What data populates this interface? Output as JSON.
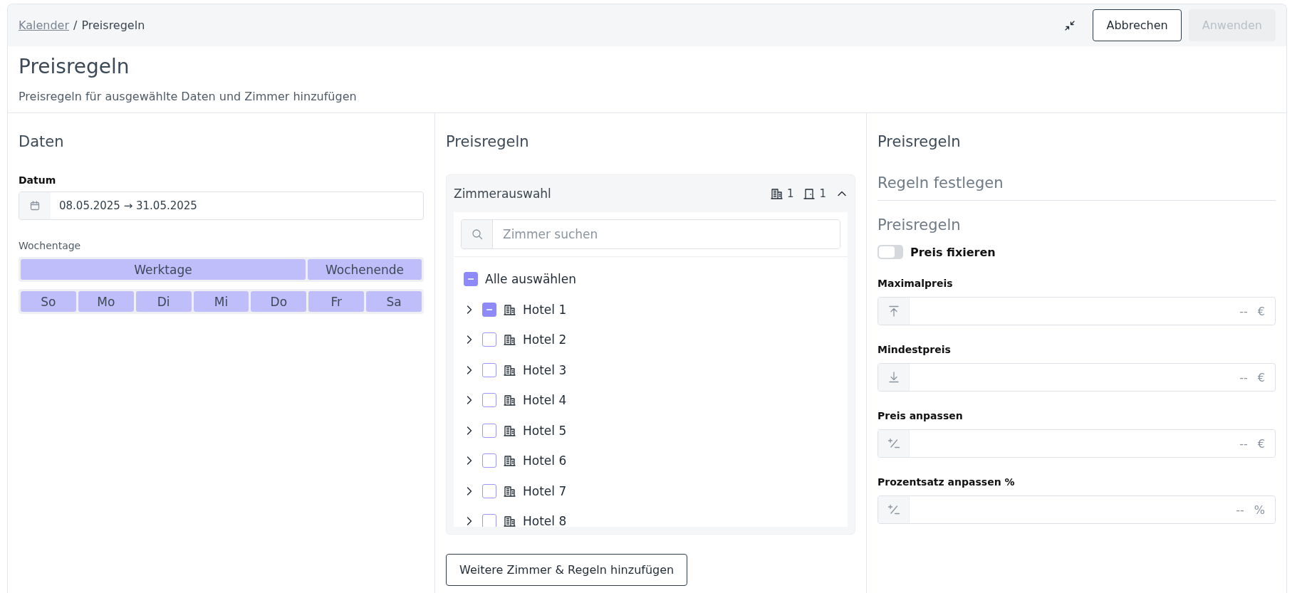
{
  "breadcrumb": {
    "link": "Kalender",
    "separator": "/",
    "current": "Preisregeln"
  },
  "toolbar": {
    "buttons": [
      {
        "label": "Abbrechen",
        "kind": "outline",
        "disabled": false
      },
      {
        "label": "Anwenden",
        "kind": "primary",
        "disabled": true
      }
    ]
  },
  "header": {
    "title": "Preisregeln",
    "subtitle": "Preisregeln für ausgewählte Daten und Zimmer hinzufügen"
  },
  "dates": {
    "title": "Daten",
    "date_label": "Datum",
    "date_value": "08.05.2025 → 31.05.2025",
    "weekdays_label": "Wochentage",
    "groups": [
      {
        "label": "Werktage",
        "selected": true
      },
      {
        "label": "Wochenende",
        "selected": true
      }
    ],
    "days": [
      {
        "label": "So",
        "selected": true
      },
      {
        "label": "Mo",
        "selected": true
      },
      {
        "label": "Di",
        "selected": true
      },
      {
        "label": "Mi",
        "selected": true
      },
      {
        "label": "Do",
        "selected": true
      },
      {
        "label": "Fr",
        "selected": true
      },
      {
        "label": "Sa",
        "selected": true
      }
    ]
  },
  "rooms": {
    "title": "Preisregeln",
    "card_title": "Zimmerauswahl",
    "hotel_count": "1",
    "room_count": "1",
    "expanded": true,
    "search_placeholder": "Zimmer suchen",
    "select_all": {
      "label": "Alle auswählen",
      "checked": false,
      "indeterminate": true
    },
    "hotels": [
      {
        "name": "Hotel 1",
        "checked": false,
        "indeterminate": true,
        "expanded": false
      },
      {
        "name": "Hotel 2",
        "checked": false,
        "indeterminate": false,
        "expanded": false
      },
      {
        "name": "Hotel 3",
        "checked": false,
        "indeterminate": false,
        "expanded": false
      },
      {
        "name": "Hotel 4",
        "checked": false,
        "indeterminate": false,
        "expanded": false
      },
      {
        "name": "Hotel 5",
        "checked": false,
        "indeterminate": false,
        "expanded": false
      },
      {
        "name": "Hotel 6",
        "checked": false,
        "indeterminate": false,
        "expanded": false
      },
      {
        "name": "Hotel 7",
        "checked": false,
        "indeterminate": false,
        "expanded": false
      },
      {
        "name": "Hotel 8",
        "checked": false,
        "indeterminate": false,
        "expanded": false
      }
    ],
    "add_button": "Weitere Zimmer & Regeln hinzufügen"
  },
  "rules": {
    "title": "Preisregeln",
    "section_title": "Regeln festlegen",
    "subsection_title": "Preisregeln",
    "fix_price": {
      "label": "Preis fixieren",
      "on": false
    },
    "fields": [
      {
        "label": "Maximalpreis",
        "kind": "max",
        "placeholder": "--",
        "unit": "€"
      },
      {
        "label": "Mindestpreis",
        "kind": "min",
        "placeholder": "--",
        "unit": "€"
      },
      {
        "label": "Preis anpassen",
        "kind": "adjust",
        "placeholder": "--",
        "unit": "€"
      },
      {
        "label": "Prozentsatz anpassen %",
        "kind": "adjust",
        "placeholder": "--",
        "unit": "%"
      }
    ]
  }
}
